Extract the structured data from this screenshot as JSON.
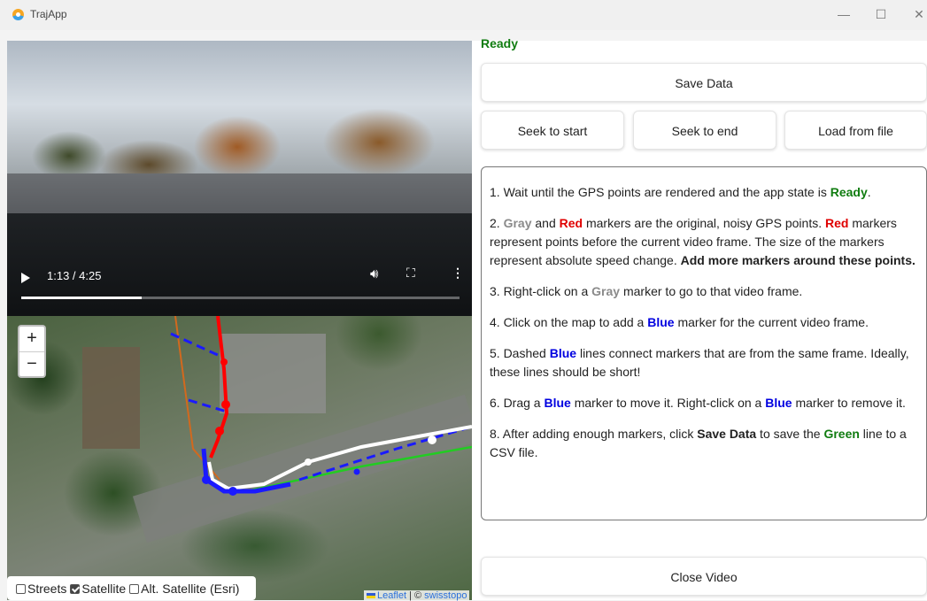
{
  "window": {
    "title": "TrajApp",
    "minimize_glyph": "—",
    "maximize_glyph": "☐",
    "close_glyph": "✕"
  },
  "video": {
    "time": "1:13 / 4:25",
    "progress": 0.275
  },
  "map": {
    "zoom_in": "+",
    "zoom_out": "−",
    "layers": {
      "streets": "Streets",
      "satellite": "Satellite",
      "alt_satellite": "Alt. Satellite (Esri)",
      "satellite_checked": true
    },
    "attribution": {
      "leaflet": "Leaflet",
      "sep": " | © ",
      "source": "swisstopo"
    }
  },
  "status": {
    "text": "Ready",
    "color": "#107c10"
  },
  "buttons": {
    "save": "Save Data",
    "seek_start": "Seek to start",
    "seek_end": "Seek to end",
    "load": "Load from file",
    "close_video": "Close Video"
  },
  "instructions": {
    "s1": {
      "t1": "1. Wait until the GPS points are rendered and the app state is ",
      "ready": "Ready",
      "t2": "."
    },
    "s2": {
      "t1": "2. ",
      "gray": "Gray",
      "t2": " and ",
      "red1": "Red",
      "t3": " markers are the original, noisy GPS points. ",
      "red2": "Red",
      "t4": " markers represent points before the current video frame. The size of the markers represent absolute speed change. ",
      "bold": "Add more markers around these points."
    },
    "s3": {
      "t1": "3. Right-click on a ",
      "gray": "Gray",
      "t2": " marker to go to that video frame."
    },
    "s4": {
      "t1": "4. Click on the map to add a ",
      "blue": "Blue",
      "t2": " marker for the current video frame."
    },
    "s5": {
      "t1": "5. Dashed ",
      "blue": "Blue",
      "t2": " lines connect markers that are from the same frame. Ideally, these lines should be short!"
    },
    "s6": {
      "t1": "6. Drag a ",
      "blue1": "Blue",
      "t2": " marker to move it. Right-click on a ",
      "blue2": "Blue",
      "t3": " marker to remove it."
    },
    "s8": {
      "t1": "8. After adding enough markers, click ",
      "save": "Save Data",
      "t2": " to save the ",
      "green": "Green",
      "t3": " line to a CSV file."
    }
  }
}
